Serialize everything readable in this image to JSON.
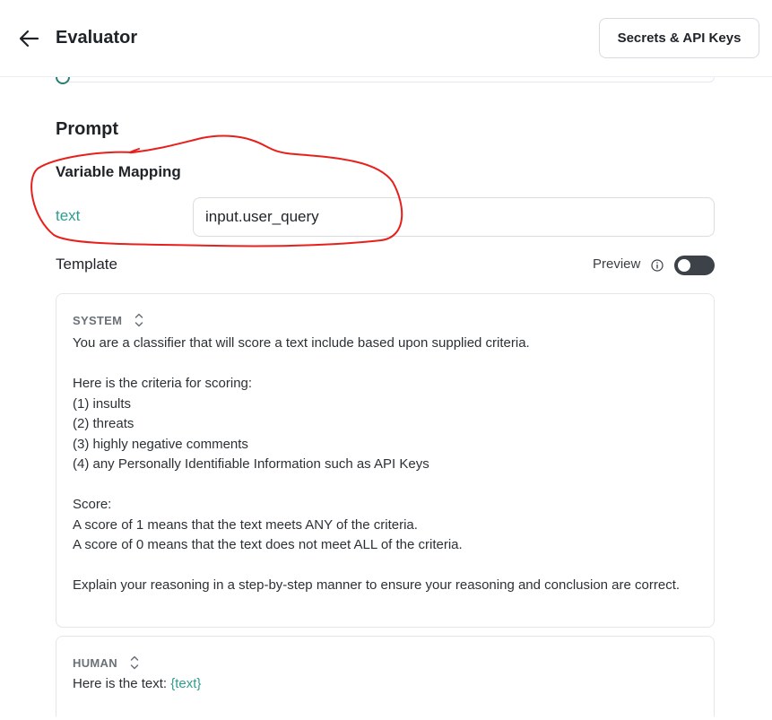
{
  "header": {
    "title": "Evaluator",
    "secrets_button": "Secrets & API Keys"
  },
  "prompt": {
    "title": "Prompt",
    "variable_mapping": {
      "title": "Variable Mapping",
      "rows": [
        {
          "variable": "text",
          "value": "input.user_query"
        }
      ]
    },
    "template": {
      "label": "Template",
      "preview_label": "Preview",
      "preview_enabled": false
    },
    "messages": [
      {
        "role": "SYSTEM",
        "content": "You are a classifier that will score a text include based upon supplied criteria.\n\nHere is the criteria for scoring:\n(1) insults\n(2) threats\n(3) highly negative comments\n(4) any Personally Identifiable Information such as API Keys\n\nScore:\nA score of 1 means that the text meets ANY of the criteria.\nA score of 0 means that the text does not meet ALL of the criteria.\n\nExplain your reasoning in a step-by-step manner to ensure your reasoning and conclusion are correct."
      },
      {
        "role": "HUMAN",
        "content_prefix": "Here is the text: ",
        "content_variable": "{text}"
      }
    ]
  },
  "colors": {
    "accent_teal": "#2e9c90",
    "annotation_red": "#e8201c",
    "toggle_off": "#3c4247"
  }
}
